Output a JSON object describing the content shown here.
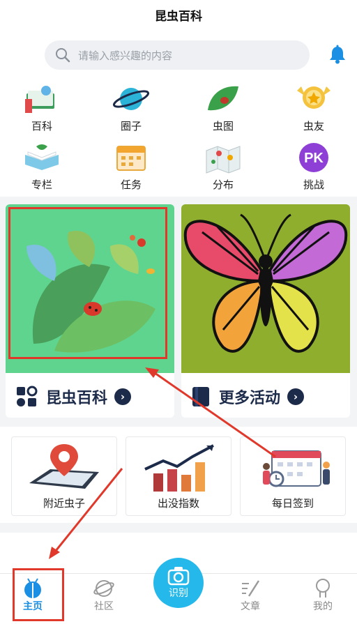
{
  "header": {
    "title": "昆虫百科"
  },
  "search": {
    "placeholder": "请输入感兴趣的内容"
  },
  "grid": [
    {
      "label": "百科",
      "icon": "book-icon"
    },
    {
      "label": "圈子",
      "icon": "planet-icon"
    },
    {
      "label": "虫图",
      "icon": "leaf-insect-icon"
    },
    {
      "label": "虫友",
      "icon": "medal-icon"
    },
    {
      "label": "专栏",
      "icon": "open-book-icon"
    },
    {
      "label": "任务",
      "icon": "calendar-icon"
    },
    {
      "label": "分布",
      "icon": "map-icon"
    },
    {
      "label": "挑战",
      "icon": "pk-icon",
      "badge": "PK"
    }
  ],
  "cards": [
    {
      "label": "昆虫百科",
      "icon": "apps-icon",
      "chevron": "›"
    },
    {
      "label": "更多活动",
      "icon": "bookmark-icon",
      "chevron": "›"
    }
  ],
  "tiles": [
    {
      "label": "附近虫子",
      "icon": "nearby-map-icon"
    },
    {
      "label": "出没指数",
      "icon": "bar-chart-icon"
    },
    {
      "label": "每日签到",
      "icon": "calendar-checkin-icon"
    }
  ],
  "tabbar": {
    "home": "主页",
    "community": "社区",
    "identify": "识别",
    "articles": "文章",
    "mine": "我的"
  },
  "colors": {
    "accent": "#1a8fe3",
    "fab": "#25b8ea",
    "highlight": "#e0392b",
    "navy": "#1d2b4a"
  }
}
